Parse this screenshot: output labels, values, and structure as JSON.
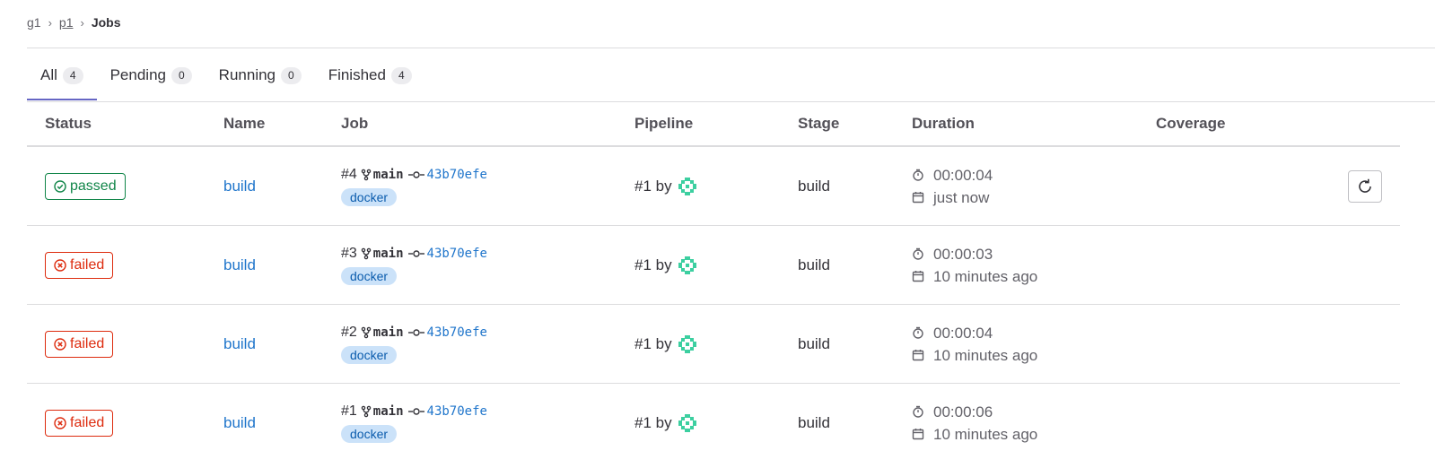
{
  "breadcrumb": {
    "group": "g1",
    "project": "p1",
    "current": "Jobs"
  },
  "tabs": [
    {
      "label": "All",
      "count": "4"
    },
    {
      "label": "Pending",
      "count": "0"
    },
    {
      "label": "Running",
      "count": "0"
    },
    {
      "label": "Finished",
      "count": "4"
    }
  ],
  "columns": {
    "status": "Status",
    "name": "Name",
    "job": "Job",
    "pipeline": "Pipeline",
    "stage": "Stage",
    "duration": "Duration",
    "coverage": "Coverage"
  },
  "jobs": [
    {
      "status": "passed",
      "name": "build",
      "id": "#4",
      "ref": "main",
      "sha": "43b70efe",
      "tag": "docker",
      "pipeline": "#1 by",
      "stage": "build",
      "duration": "00:00:04",
      "finished": "just now"
    },
    {
      "status": "failed",
      "name": "build",
      "id": "#3",
      "ref": "main",
      "sha": "43b70efe",
      "tag": "docker",
      "pipeline": "#1 by",
      "stage": "build",
      "duration": "00:00:03",
      "finished": "10 minutes ago"
    },
    {
      "status": "failed",
      "name": "build",
      "id": "#2",
      "ref": "main",
      "sha": "43b70efe",
      "tag": "docker",
      "pipeline": "#1 by",
      "stage": "build",
      "duration": "00:00:04",
      "finished": "10 minutes ago"
    },
    {
      "status": "failed",
      "name": "build",
      "id": "#1",
      "ref": "main",
      "sha": "43b70efe",
      "tag": "docker",
      "pipeline": "#1 by",
      "stage": "build",
      "duration": "00:00:06",
      "finished": "10 minutes ago"
    }
  ],
  "icons": {
    "status_passed": "check-circle-icon",
    "status_failed": "x-circle-icon",
    "branch": "branch-icon",
    "commit": "commit-icon",
    "timer": "stopwatch-icon",
    "calendar": "calendar-icon",
    "retry": "retry-icon"
  },
  "colors": {
    "passed": "#108548",
    "failed": "#dd2b0e",
    "link": "#1f75cb",
    "tab_active": "#6666c4",
    "tag_bg": "#cbe2f9"
  }
}
